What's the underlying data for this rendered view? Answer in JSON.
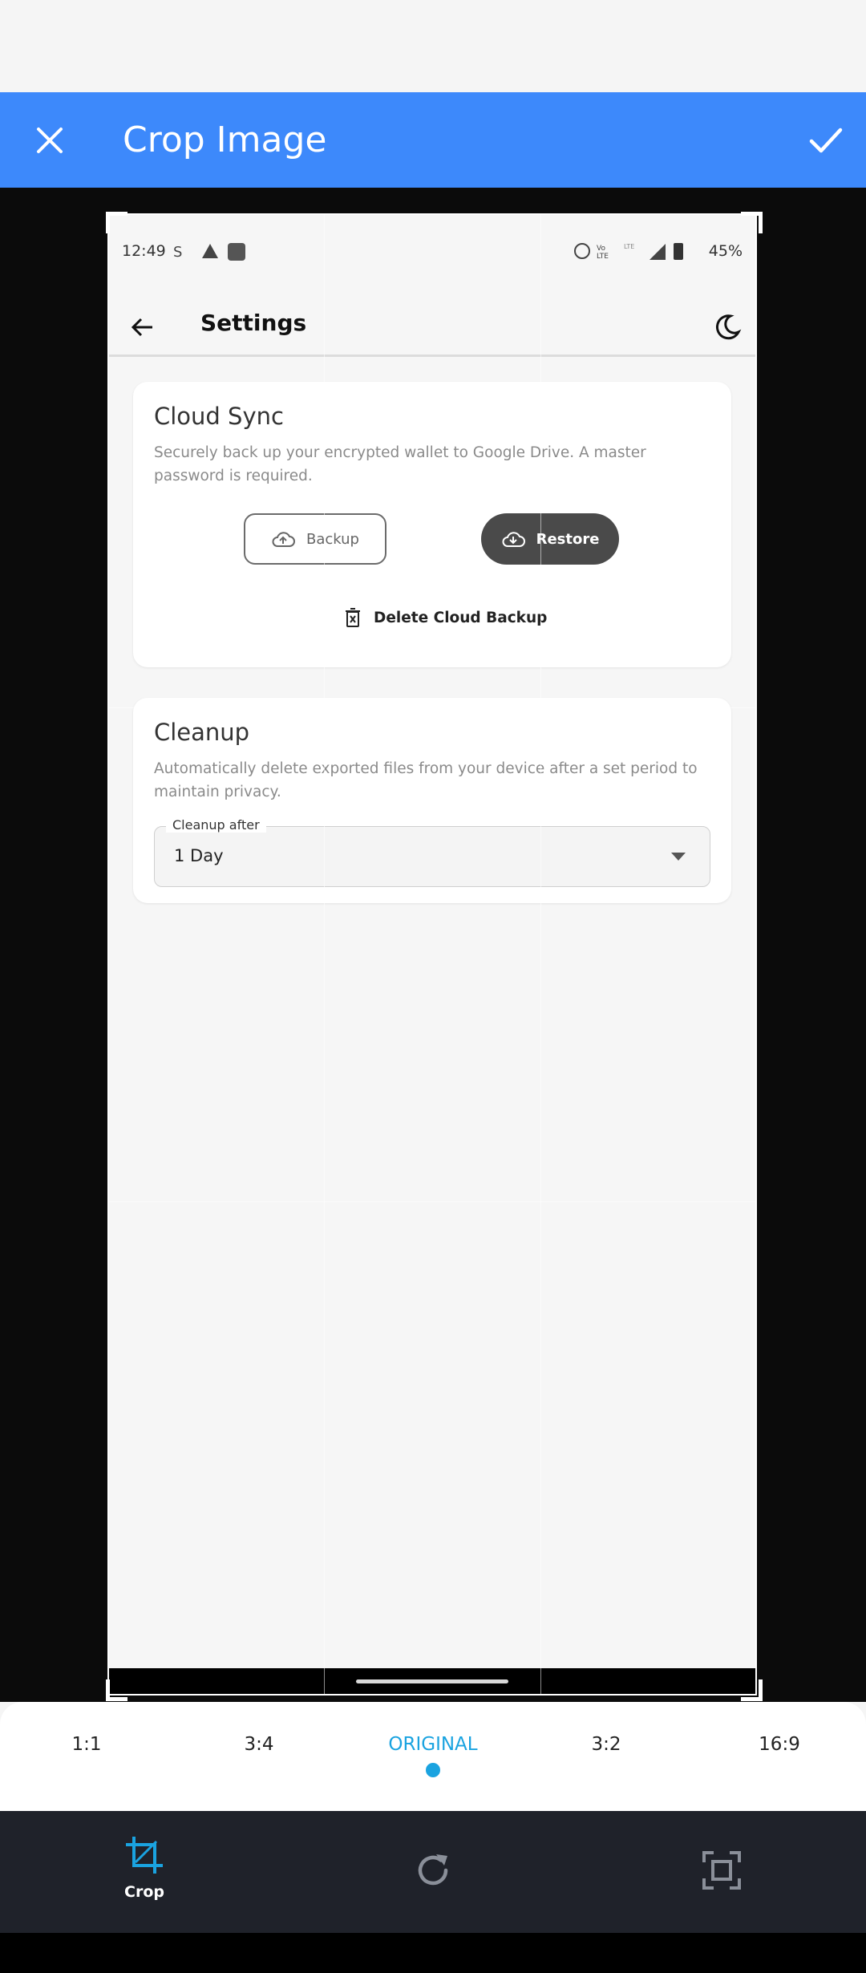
{
  "app_bar": {
    "title": "Crop Image",
    "close_icon": "close-icon",
    "confirm_icon": "check-icon",
    "background": "#3d89fb"
  },
  "preview": {
    "status_bar": {
      "time": "12:49",
      "battery": "45%"
    },
    "header": {
      "title": "Settings"
    },
    "cloud_sync": {
      "title": "Cloud Sync",
      "description": "Securely back up your encrypted wallet to Google Drive. A master password is required.",
      "backup_label": "Backup",
      "restore_label": "Restore",
      "delete_label": "Delete Cloud Backup"
    },
    "cleanup": {
      "title": "Cleanup",
      "description": "Automatically delete exported files from your device after a set period to maintain privacy.",
      "field_label": "Cleanup after",
      "field_value": "1 Day"
    }
  },
  "ratios": {
    "items": [
      "1:1",
      "3:4",
      "ORIGINAL",
      "3:2",
      "16:9"
    ],
    "active": "ORIGINAL",
    "accent": "#1aa3e0"
  },
  "toolbar": {
    "crop_label": "Crop"
  }
}
